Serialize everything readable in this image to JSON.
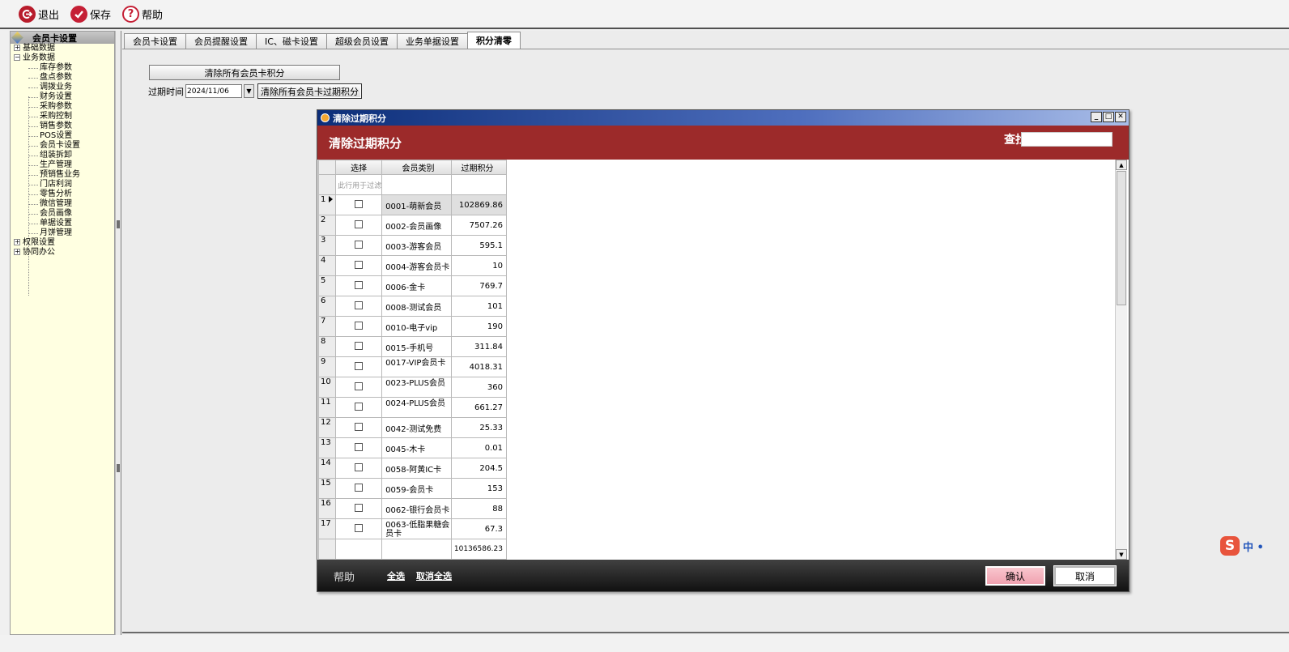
{
  "toolbar": {
    "exit_label": "退出",
    "save_label": "保存",
    "help_label": "帮助"
  },
  "tree": {
    "header": "会员卡设置",
    "nodes": [
      {
        "label": "基础数据",
        "expander": "+",
        "level": 0
      },
      {
        "label": "业务数据",
        "expander": "−",
        "level": 0
      },
      {
        "label": "库存参数",
        "level": 1
      },
      {
        "label": "盘点参数",
        "level": 1
      },
      {
        "label": "调拨业务",
        "level": 1
      },
      {
        "label": "财务设置",
        "level": 1
      },
      {
        "label": "采购参数",
        "level": 1
      },
      {
        "label": "采购控制",
        "level": 1
      },
      {
        "label": "销售参数",
        "level": 1
      },
      {
        "label": "POS设置",
        "level": 1
      },
      {
        "label": "会员卡设置",
        "level": 1
      },
      {
        "label": "组装拆卸",
        "level": 1
      },
      {
        "label": "生产管理",
        "level": 1
      },
      {
        "label": "预销售业务",
        "level": 1
      },
      {
        "label": "门店利润",
        "level": 1
      },
      {
        "label": "零售分析",
        "level": 1
      },
      {
        "label": "微信管理",
        "level": 1
      },
      {
        "label": "会员画像",
        "level": 1
      },
      {
        "label": "单据设置",
        "level": 1
      },
      {
        "label": "月饼管理",
        "level": 1
      },
      {
        "label": "权限设置",
        "expander": "+",
        "level": 0
      },
      {
        "label": "协同办公",
        "expander": "+",
        "level": 0
      }
    ]
  },
  "tabs": [
    {
      "label": "会员卡设置",
      "active": false
    },
    {
      "label": "会员提醒设置",
      "active": false
    },
    {
      "label": "IC、磁卡设置",
      "active": false
    },
    {
      "label": "超级会员设置",
      "active": false
    },
    {
      "label": "业务单据设置",
      "active": false
    },
    {
      "label": "积分清零",
      "active": true
    }
  ],
  "points_clear": {
    "clear_all_button": "清除所有会员卡积分",
    "expire_label": "过期时间",
    "expire_date": "2024/11/06",
    "clear_expired_button": "清除所有会员卡过期积分"
  },
  "dialog": {
    "title": "清除过期积分",
    "header": "清除过期积分",
    "search_label": "查找",
    "search_value": "",
    "columns": {
      "select": "选择",
      "type": "会员类别",
      "points": "过期积分"
    },
    "filter_hint": "此行用于过滤",
    "rows": [
      {
        "no": "1",
        "type": "0001-萌新会员",
        "points": "102869.86"
      },
      {
        "no": "2",
        "type": "0002-会员画像",
        "points": "7507.26"
      },
      {
        "no": "3",
        "type": "0003-游客会员",
        "points": "595.1"
      },
      {
        "no": "4",
        "type": "0004-游客会员卡",
        "points": "10"
      },
      {
        "no": "5",
        "type": "0006-金卡",
        "points": "769.7"
      },
      {
        "no": "6",
        "type": "0008-测试会员",
        "points": "101"
      },
      {
        "no": "7",
        "type": "0010-电子vip",
        "points": "190"
      },
      {
        "no": "8",
        "type": "0015-手机号",
        "points": "311.84"
      },
      {
        "no": "9",
        "type": "0017-VIP会员卡",
        "points": "4018.31"
      },
      {
        "no": "10",
        "type": "0023-PLUS会员",
        "points": "360"
      },
      {
        "no": "11",
        "type": "0024-PLUS会员",
        "points": "661.27"
      },
      {
        "no": "12",
        "type": "0042-测试免费",
        "points": "25.33"
      },
      {
        "no": "13",
        "type": "0045-木卡",
        "points": "0.01"
      },
      {
        "no": "14",
        "type": "0058-阿黄IC卡",
        "points": "204.5"
      },
      {
        "no": "15",
        "type": "0059-会员卡",
        "points": "153"
      },
      {
        "no": "16",
        "type": "0062-银行会员卡",
        "points": "88"
      },
      {
        "no": "17",
        "type": "0063-低脂果糖会员卡",
        "points": "67.3"
      }
    ],
    "total": "10136586.23",
    "footer": {
      "help": "帮助",
      "select_all": "全选",
      "deselect_all": "取消全选",
      "ok": "确认",
      "cancel": "取消"
    }
  },
  "ime": {
    "logo": "S",
    "text": "中 •"
  },
  "colors": {
    "dialog_header": "#9c2a2a",
    "tree_bg": "#ffffe1",
    "titlebar": "#0c2e79",
    "ok_button": "#f0a2b0"
  }
}
